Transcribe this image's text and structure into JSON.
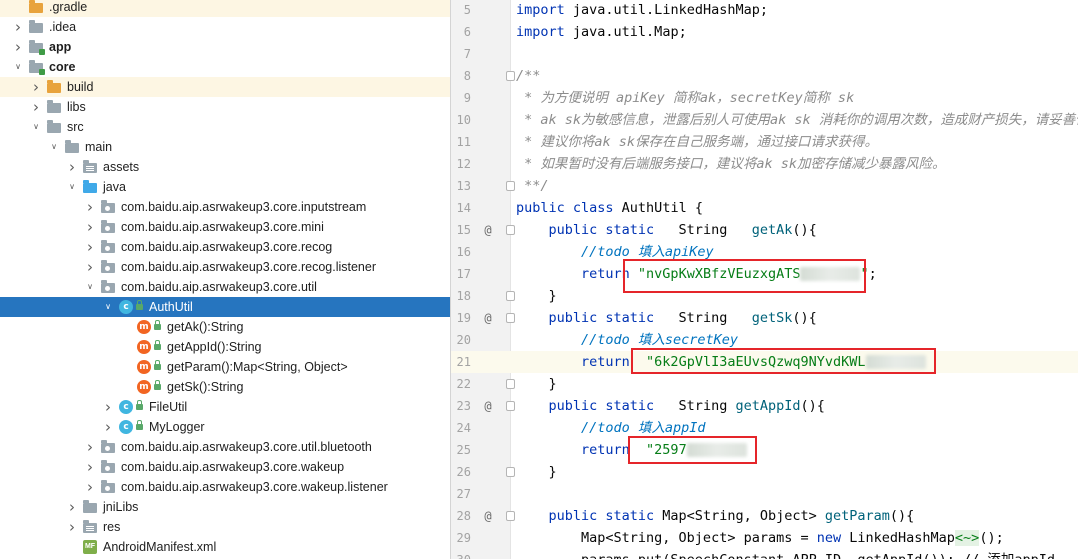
{
  "tree": {
    "items": [
      {
        "label": ".gradle",
        "depth": 0,
        "arrow": "",
        "icon": "folder-icon",
        "iconClass": "ic-folder orange",
        "bold": false,
        "state": "hl"
      },
      {
        "label": ".idea",
        "depth": 0,
        "arrow": ">",
        "icon": "folder-icon",
        "iconClass": "ic-folder",
        "bold": false,
        "state": ""
      },
      {
        "label": "app",
        "depth": 0,
        "arrow": ">",
        "icon": "module-folder-icon",
        "iconClass": "ic-folder module",
        "bold": true,
        "state": ""
      },
      {
        "label": "core",
        "depth": 0,
        "arrow": "v",
        "icon": "module-folder-icon",
        "iconClass": "ic-folder module",
        "bold": true,
        "state": ""
      },
      {
        "label": "build",
        "depth": 1,
        "arrow": ">",
        "icon": "folder-icon",
        "iconClass": "ic-folder orange",
        "bold": false,
        "state": "hl"
      },
      {
        "label": "libs",
        "depth": 1,
        "arrow": ">",
        "icon": "folder-icon",
        "iconClass": "ic-folder",
        "bold": false,
        "state": ""
      },
      {
        "label": "src",
        "depth": 1,
        "arrow": "v",
        "icon": "folder-icon",
        "iconClass": "ic-folder",
        "bold": false,
        "state": ""
      },
      {
        "label": "main",
        "depth": 2,
        "arrow": "v",
        "icon": "folder-icon",
        "iconClass": "ic-folder",
        "bold": false,
        "state": ""
      },
      {
        "label": "assets",
        "depth": 3,
        "arrow": ">",
        "icon": "resource-folder-icon",
        "iconClass": "ic-folder stripe",
        "bold": false,
        "state": ""
      },
      {
        "label": "java",
        "depth": 3,
        "arrow": "v",
        "icon": "source-folder-icon",
        "iconClass": "ic-folder blue",
        "bold": false,
        "state": ""
      },
      {
        "label": "com.baidu.aip.asrwakeup3.core.inputstream",
        "depth": 4,
        "arrow": ">",
        "icon": "package-icon",
        "iconClass": "ic-folder pkg",
        "bold": false,
        "state": ""
      },
      {
        "label": "com.baidu.aip.asrwakeup3.core.mini",
        "depth": 4,
        "arrow": ">",
        "icon": "package-icon",
        "iconClass": "ic-folder pkg",
        "bold": false,
        "state": ""
      },
      {
        "label": "com.baidu.aip.asrwakeup3.core.recog",
        "depth": 4,
        "arrow": ">",
        "icon": "package-icon",
        "iconClass": "ic-folder pkg",
        "bold": false,
        "state": ""
      },
      {
        "label": "com.baidu.aip.asrwakeup3.core.recog.listener",
        "depth": 4,
        "arrow": ">",
        "icon": "package-icon",
        "iconClass": "ic-folder pkg",
        "bold": false,
        "state": ""
      },
      {
        "label": "com.baidu.aip.asrwakeup3.core.util",
        "depth": 4,
        "arrow": "v",
        "icon": "package-icon",
        "iconClass": "ic-folder pkg",
        "bold": false,
        "state": ""
      },
      {
        "label": "AuthUtil",
        "depth": 5,
        "arrow": "v",
        "icon": "class-icon",
        "iconClass": "ic-class",
        "iconText": "c",
        "lock": true,
        "bold": false,
        "state": "sel"
      },
      {
        "label": "getAk():String",
        "depth": 6,
        "arrow": "",
        "icon": "method-icon",
        "iconClass": "ic-method",
        "iconText": "m",
        "lock": true,
        "bold": false,
        "state": ""
      },
      {
        "label": "getAppId():String",
        "depth": 6,
        "arrow": "",
        "icon": "method-icon",
        "iconClass": "ic-method",
        "iconText": "m",
        "lock": true,
        "bold": false,
        "state": ""
      },
      {
        "label": "getParam():Map<String, Object>",
        "depth": 6,
        "arrow": "",
        "icon": "method-icon",
        "iconClass": "ic-method",
        "iconText": "m",
        "lock": true,
        "bold": false,
        "state": ""
      },
      {
        "label": "getSk():String",
        "depth": 6,
        "arrow": "",
        "icon": "method-icon",
        "iconClass": "ic-method",
        "iconText": "m",
        "lock": true,
        "bold": false,
        "state": ""
      },
      {
        "label": "FileUtil",
        "depth": 5,
        "arrow": ">",
        "icon": "class-icon",
        "iconClass": "ic-class",
        "iconText": "c",
        "lock": true,
        "bold": false,
        "state": ""
      },
      {
        "label": "MyLogger",
        "depth": 5,
        "arrow": ">",
        "icon": "class-icon",
        "iconClass": "ic-class",
        "iconText": "c",
        "lock": true,
        "bold": false,
        "state": ""
      },
      {
        "label": "com.baidu.aip.asrwakeup3.core.util.bluetooth",
        "depth": 4,
        "arrow": ">",
        "icon": "package-icon",
        "iconClass": "ic-folder pkg",
        "bold": false,
        "state": ""
      },
      {
        "label": "com.baidu.aip.asrwakeup3.core.wakeup",
        "depth": 4,
        "arrow": ">",
        "icon": "package-icon",
        "iconClass": "ic-folder pkg",
        "bold": false,
        "state": ""
      },
      {
        "label": "com.baidu.aip.asrwakeup3.core.wakeup.listener",
        "depth": 4,
        "arrow": ">",
        "icon": "package-icon",
        "iconClass": "ic-folder pkg",
        "bold": false,
        "state": ""
      },
      {
        "label": "jniLibs",
        "depth": 3,
        "arrow": ">",
        "icon": "folder-icon",
        "iconClass": "ic-folder",
        "bold": false,
        "state": ""
      },
      {
        "label": "res",
        "depth": 3,
        "arrow": ">",
        "icon": "resource-folder-icon",
        "iconClass": "ic-folder stripe",
        "bold": false,
        "state": ""
      },
      {
        "label": "AndroidManifest.xml",
        "depth": 3,
        "arrow": "",
        "icon": "manifest-icon",
        "iconClass": "ic-manifest",
        "iconText": "MF",
        "bold": false,
        "state": ""
      }
    ]
  },
  "editor": {
    "lines": [
      {
        "num": "5",
        "mark": "",
        "fold": false,
        "hl": false,
        "tokens": [
          {
            "t": "import",
            "c": "kw"
          },
          {
            "t": " java.util.LinkedHashMap;",
            "c": "plain"
          }
        ]
      },
      {
        "num": "6",
        "mark": "",
        "fold": false,
        "hl": false,
        "tokens": [
          {
            "t": "import",
            "c": "kw"
          },
          {
            "t": " java.util.Map;",
            "c": "plain"
          }
        ]
      },
      {
        "num": "7",
        "mark": "",
        "fold": false,
        "hl": false,
        "tokens": []
      },
      {
        "num": "8",
        "mark": "",
        "fold": true,
        "hl": false,
        "tokens": [
          {
            "t": "/**",
            "c": "doc"
          }
        ]
      },
      {
        "num": "9",
        "mark": "",
        "fold": false,
        "hl": false,
        "tokens": [
          {
            "t": " * 为方便说明 apiKey 简称ak，secretKey简称 sk",
            "c": "doc"
          }
        ]
      },
      {
        "num": "10",
        "mark": "",
        "fold": false,
        "hl": false,
        "tokens": [
          {
            "t": " * ak sk为敏感信息，泄露后别人可使用ak sk 消耗你的调用次数，造成财产损失，请妥善保存",
            "c": "doc"
          }
        ]
      },
      {
        "num": "11",
        "mark": "",
        "fold": false,
        "hl": false,
        "tokens": [
          {
            "t": " * 建议你将ak sk保存在自己服务端，通过接口请求获得。",
            "c": "doc"
          }
        ]
      },
      {
        "num": "12",
        "mark": "",
        "fold": false,
        "hl": false,
        "tokens": [
          {
            "t": " * 如果暂时没有后端服务接口，建议将ak sk加密存储减少暴露风险。",
            "c": "doc"
          }
        ]
      },
      {
        "num": "13",
        "mark": "",
        "fold": true,
        "hl": false,
        "tokens": [
          {
            "t": " **/",
            "c": "doc"
          }
        ]
      },
      {
        "num": "14",
        "mark": "",
        "fold": false,
        "hl": false,
        "tokens": [
          {
            "t": "public class",
            "c": "kw"
          },
          {
            "t": " AuthUtil {",
            "c": "plain"
          }
        ]
      },
      {
        "num": "15",
        "mark": "@",
        "fold": true,
        "hl": false,
        "tokens": [
          {
            "t": "    public static",
            "c": "kw"
          },
          {
            "t": "   String   ",
            "c": "plain"
          },
          {
            "t": "getAk",
            "c": "method"
          },
          {
            "t": "(){",
            "c": "plain"
          }
        ]
      },
      {
        "num": "16",
        "mark": "",
        "fold": false,
        "hl": false,
        "tokens": [
          {
            "t": "        //todo 填入apiKey",
            "c": "todo"
          }
        ]
      },
      {
        "num": "17",
        "mark": "",
        "fold": false,
        "hl": false,
        "tokens": [
          {
            "t": "        return",
            "c": "kw"
          },
          {
            "t": " \"nvGpKwXBfzVEuzxgATS",
            "c": "str"
          },
          {
            "t": "",
            "c": "blur"
          },
          {
            "t": "\"",
            "c": "str"
          },
          {
            "t": ";",
            "c": "plain"
          }
        ]
      },
      {
        "num": "18",
        "mark": "",
        "fold": true,
        "hl": false,
        "tokens": [
          {
            "t": "    }",
            "c": "plain"
          }
        ]
      },
      {
        "num": "19",
        "mark": "@",
        "fold": true,
        "hl": false,
        "tokens": [
          {
            "t": "    public static",
            "c": "kw"
          },
          {
            "t": "   String   ",
            "c": "plain"
          },
          {
            "t": "getSk",
            "c": "method"
          },
          {
            "t": "(){",
            "c": "plain"
          }
        ]
      },
      {
        "num": "20",
        "mark": "",
        "fold": false,
        "hl": false,
        "tokens": [
          {
            "t": "        //todo 填入secretKey",
            "c": "todo"
          }
        ]
      },
      {
        "num": "21",
        "mark": "",
        "fold": false,
        "hl": true,
        "tokens": [
          {
            "t": "        return",
            "c": "kw"
          },
          {
            "t": "  \"6k2GpVlI3aEUvsQzwq9NYvdKWL",
            "c": "str"
          },
          {
            "t": "",
            "c": "blur"
          }
        ]
      },
      {
        "num": "22",
        "mark": "",
        "fold": true,
        "hl": false,
        "tokens": [
          {
            "t": "    }",
            "c": "plain"
          }
        ]
      },
      {
        "num": "23",
        "mark": "@",
        "fold": true,
        "hl": false,
        "tokens": [
          {
            "t": "    public static",
            "c": "kw"
          },
          {
            "t": "   String ",
            "c": "plain"
          },
          {
            "t": "getAppId",
            "c": "method"
          },
          {
            "t": "(){",
            "c": "plain"
          }
        ]
      },
      {
        "num": "24",
        "mark": "",
        "fold": false,
        "hl": false,
        "tokens": [
          {
            "t": "        //todo 填入appId",
            "c": "todo"
          }
        ]
      },
      {
        "num": "25",
        "mark": "",
        "fold": false,
        "hl": false,
        "tokens": [
          {
            "t": "        return",
            "c": "kw"
          },
          {
            "t": "  \"2597",
            "c": "str"
          },
          {
            "t": "",
            "c": "blur"
          }
        ]
      },
      {
        "num": "26",
        "mark": "",
        "fold": true,
        "hl": false,
        "tokens": [
          {
            "t": "    }",
            "c": "plain"
          }
        ]
      },
      {
        "num": "27",
        "mark": "",
        "fold": false,
        "hl": false,
        "tokens": []
      },
      {
        "num": "28",
        "mark": "@",
        "fold": true,
        "hl": false,
        "tokens": [
          {
            "t": "    public static",
            "c": "kw"
          },
          {
            "t": " Map<String, Object> ",
            "c": "plain"
          },
          {
            "t": "getParam",
            "c": "method"
          },
          {
            "t": "(){",
            "c": "plain"
          }
        ]
      },
      {
        "num": "29",
        "mark": "",
        "fold": false,
        "hl": false,
        "tokens": [
          {
            "t": "        Map<String, Object> params = ",
            "c": "plain"
          },
          {
            "t": "new",
            "c": "kw"
          },
          {
            "t": " LinkedHashMap",
            "c": "plain"
          },
          {
            "t": "<~>",
            "c": "hint"
          },
          {
            "t": "();",
            "c": "plain"
          }
        ]
      },
      {
        "num": "30",
        "mark": "",
        "fold": false,
        "hl": false,
        "tokens": [
          {
            "t": "        params.put(SpeechConstant.APP_ID, getAppId()); // 添加appId",
            "c": "plain"
          }
        ]
      }
    ]
  },
  "colors": {
    "selection": "#2675bf",
    "annotation": "#e5252a",
    "keyword": "#0033b3",
    "string": "#067d17",
    "todo": "#0073bf",
    "docComment": "#8c8c8c"
  }
}
